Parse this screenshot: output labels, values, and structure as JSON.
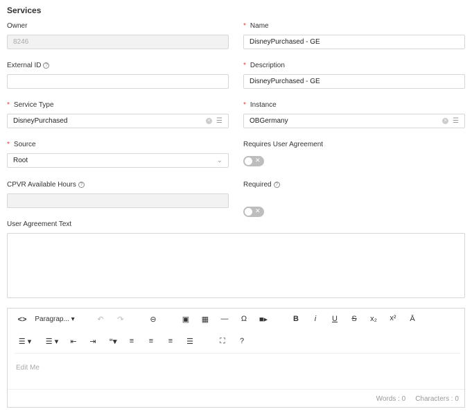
{
  "title": "Services",
  "owner": {
    "label": "Owner",
    "value": "8246"
  },
  "name": {
    "label": "Name",
    "value": "DisneyPurchased - GE"
  },
  "external_id": {
    "label": "External ID",
    "value": ""
  },
  "description": {
    "label": "Description",
    "value": "DisneyPurchased - GE"
  },
  "service_type": {
    "label": "Service Type",
    "value": "DisneyPurchased"
  },
  "instance": {
    "label": "Instance",
    "value": "OBGermany"
  },
  "source": {
    "label": "Source",
    "value": "Root"
  },
  "requires_user_agreement": {
    "label": "Requires User Agreement",
    "on": false
  },
  "cpvr": {
    "label": "CPVR Available Hours",
    "value": ""
  },
  "required": {
    "label": "Required",
    "on": false
  },
  "user_agreement_text": {
    "label": "User Agreement Text",
    "value": ""
  },
  "editor": {
    "paragraph": "Paragrap...",
    "placeholder": "Edit Me",
    "words": "Words : 0",
    "characters": "Characters : 0"
  },
  "icons": {
    "required_mark": "*",
    "help": "?",
    "clear": "×",
    "toggle_off": "✕"
  }
}
